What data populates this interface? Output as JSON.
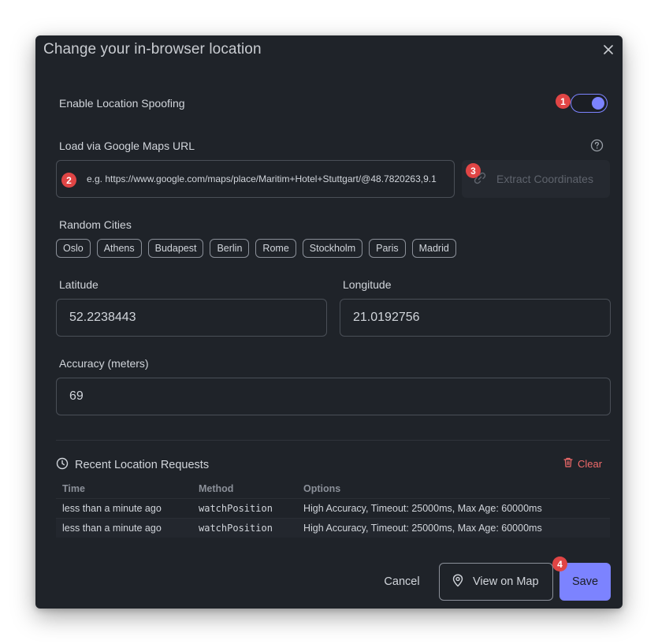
{
  "dialog": {
    "title": "Change your in-browser location"
  },
  "spoofing": {
    "label": "Enable Location Spoofing",
    "enabled": true
  },
  "google_maps": {
    "label": "Load via Google Maps URL",
    "placeholder": "e.g. https://www.google.com/maps/place/Maritim+Hotel+Stuttgart/@48.7820263,9.1",
    "extract_label": "Extract Coordinates"
  },
  "random_cities": {
    "label": "Random Cities",
    "cities": [
      "Oslo",
      "Athens",
      "Budapest",
      "Berlin",
      "Rome",
      "Stockholm",
      "Paris",
      "Madrid"
    ]
  },
  "latitude": {
    "label": "Latitude",
    "value": "52.2238443"
  },
  "longitude": {
    "label": "Longitude",
    "value": "21.0192756"
  },
  "accuracy": {
    "label": "Accuracy (meters)",
    "value": "69"
  },
  "recent": {
    "title": "Recent Location Requests",
    "clear_label": "Clear",
    "columns": [
      "Time",
      "Method",
      "Options"
    ],
    "rows": [
      [
        "less than a minute ago",
        "watchPosition",
        "High Accuracy, Timeout: 25000ms, Max Age: 60000ms"
      ],
      [
        "less than a minute ago",
        "watchPosition",
        "High Accuracy, Timeout: 25000ms, Max Age: 60000ms"
      ]
    ]
  },
  "footer": {
    "cancel_label": "Cancel",
    "view_map_label": "View on Map",
    "save_label": "Save"
  },
  "badges": [
    "1",
    "2",
    "3",
    "4"
  ],
  "colors": {
    "accent": "#7c83ff",
    "badge": "#e04545",
    "danger": "#f06a6a",
    "background": "#1f2329"
  }
}
